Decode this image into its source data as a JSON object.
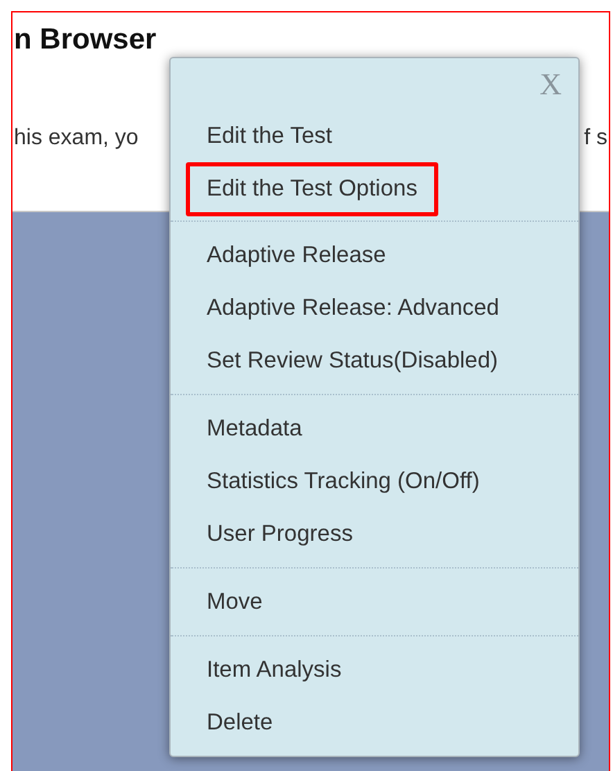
{
  "page": {
    "title": "n Browser",
    "text_left": "his exam, yo",
    "text_right": "f s"
  },
  "menu": {
    "close": "X",
    "groups": [
      {
        "items": [
          {
            "label": "Edit the Test",
            "highlighted": false
          },
          {
            "label": "Edit the Test Options",
            "highlighted": true
          }
        ]
      },
      {
        "items": [
          {
            "label": "Adaptive Release",
            "highlighted": false
          },
          {
            "label": "Adaptive Release: Advanced",
            "highlighted": false
          },
          {
            "label": "Set Review Status(Disabled)",
            "highlighted": false
          }
        ]
      },
      {
        "items": [
          {
            "label": "Metadata",
            "highlighted": false
          },
          {
            "label": "Statistics Tracking (On/Off)",
            "highlighted": false
          },
          {
            "label": "User Progress",
            "highlighted": false
          }
        ]
      },
      {
        "items": [
          {
            "label": "Move",
            "highlighted": false
          }
        ]
      },
      {
        "items": [
          {
            "label": "Item Analysis",
            "highlighted": false
          },
          {
            "label": "Delete",
            "highlighted": false
          }
        ]
      }
    ]
  }
}
